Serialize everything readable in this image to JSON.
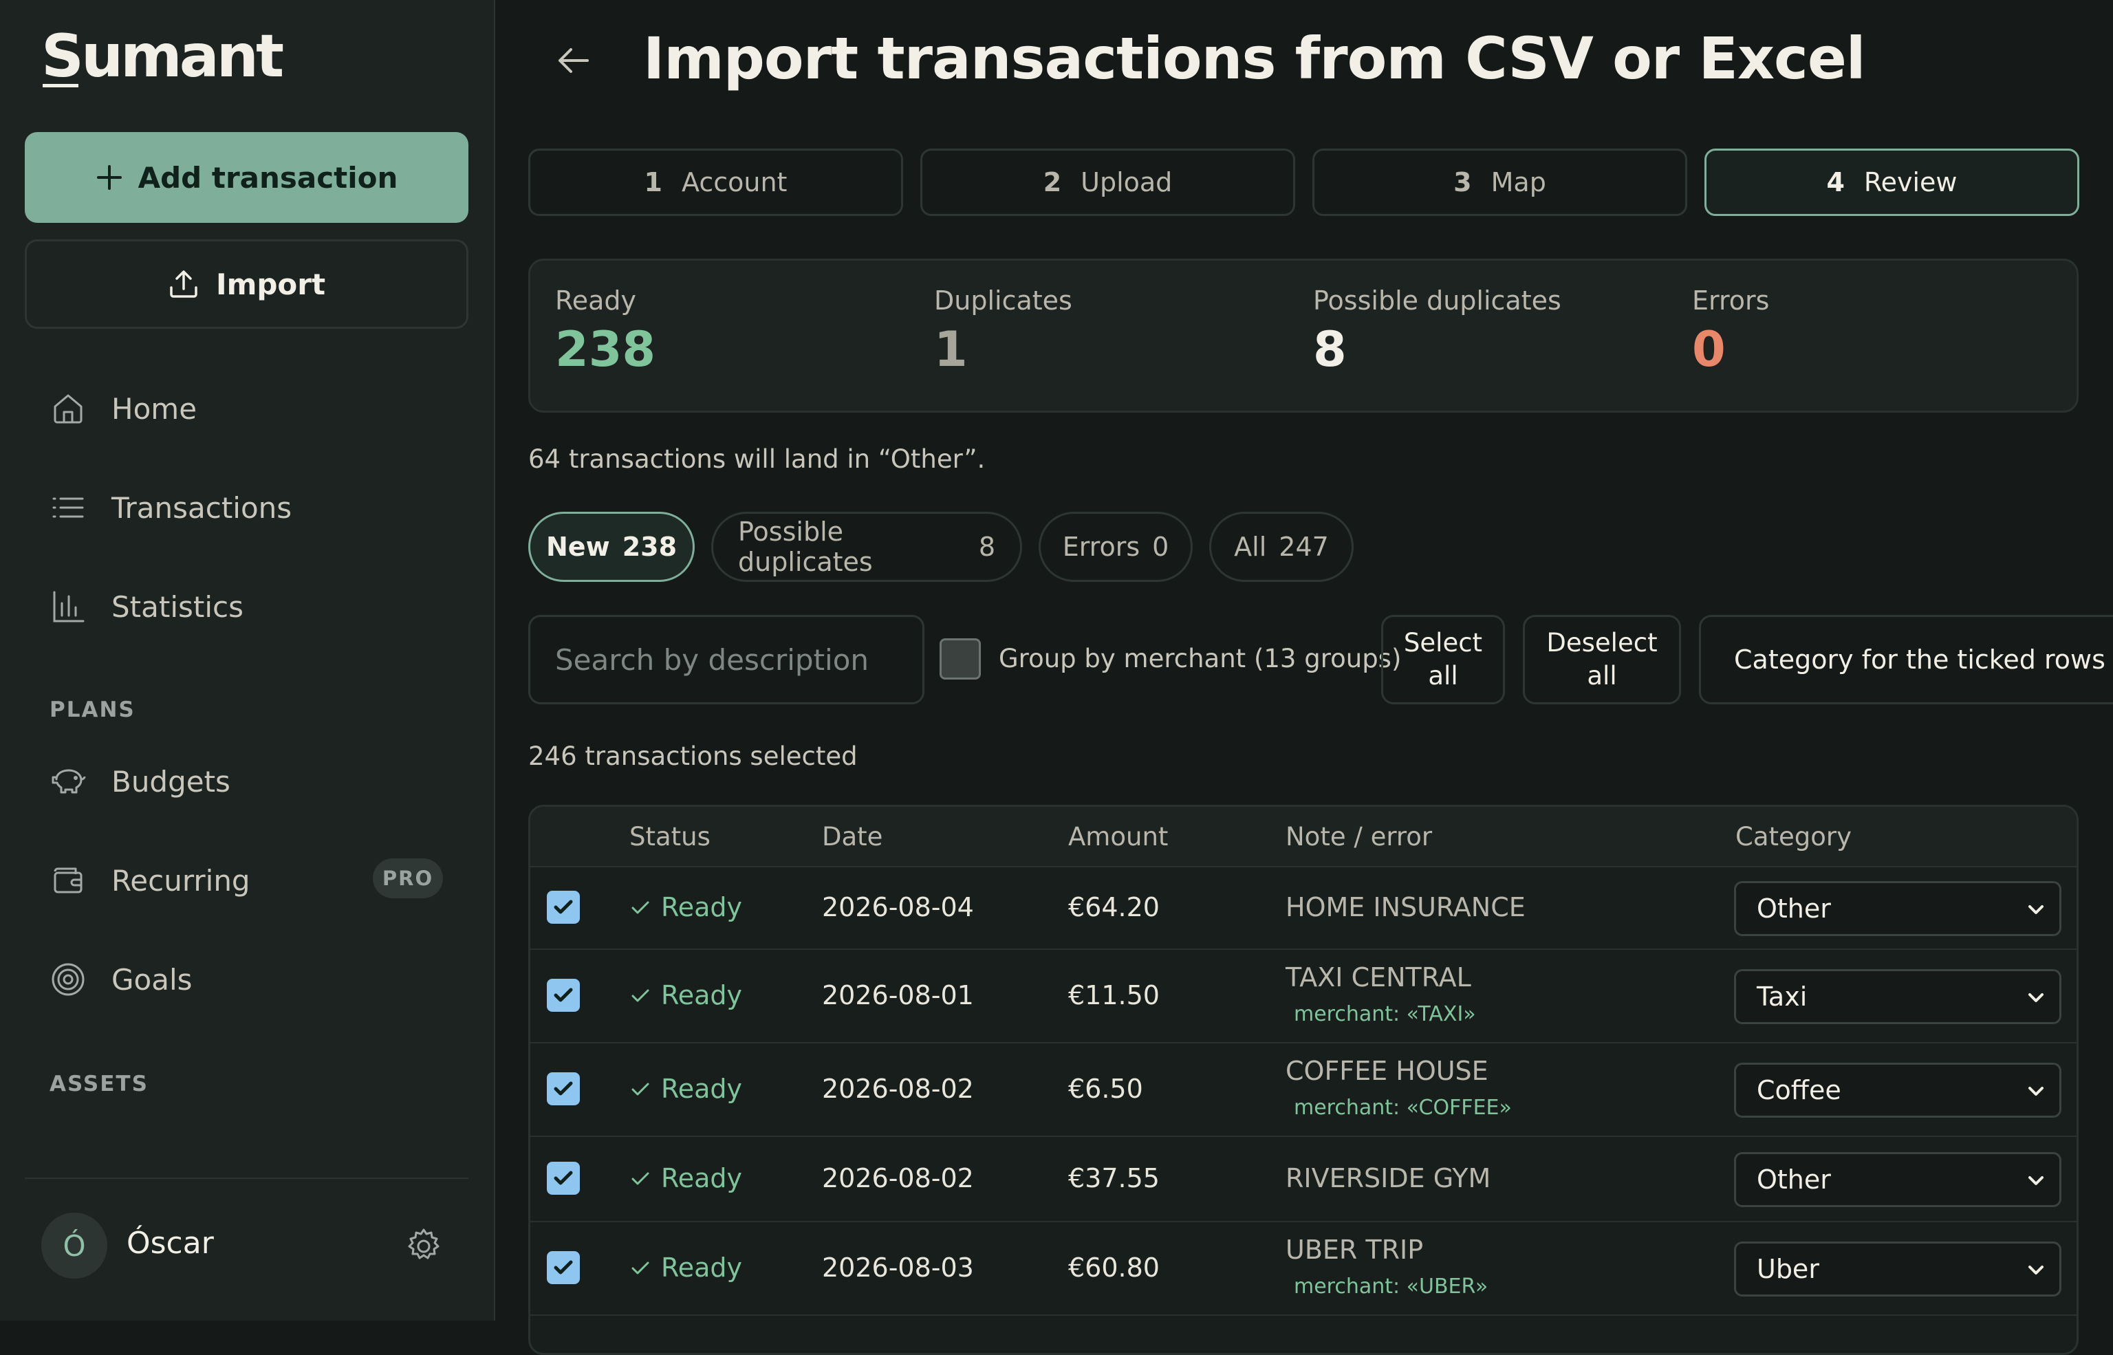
{
  "brand": {
    "name": "Sumant"
  },
  "sidebar": {
    "add_label": "Add transaction",
    "import_label": "Import",
    "nav": [
      {
        "label": "Home",
        "icon": "home-icon"
      },
      {
        "label": "Transactions",
        "icon": "list-icon"
      },
      {
        "label": "Statistics",
        "icon": "bar-chart-icon"
      }
    ],
    "plans_label": "PLANS",
    "plans": [
      {
        "label": "Budgets",
        "icon": "piggy-bank-icon"
      },
      {
        "label": "Recurring",
        "icon": "wallet-icon",
        "badge": "PRO"
      },
      {
        "label": "Goals",
        "icon": "target-icon"
      }
    ],
    "assets_label": "ASSETS",
    "user": {
      "initial": "Ó",
      "name": "Óscar"
    }
  },
  "page": {
    "title": "Import transactions from CSV or Excel"
  },
  "steps": [
    {
      "num": "1",
      "label": "Account"
    },
    {
      "num": "2",
      "label": "Upload"
    },
    {
      "num": "3",
      "label": "Map"
    },
    {
      "num": "4",
      "label": "Review",
      "active": true
    }
  ],
  "stats": [
    {
      "label": "Ready",
      "value": "238",
      "color": "#7fc49a"
    },
    {
      "label": "Duplicates",
      "value": "1",
      "color": "#a7a49a"
    },
    {
      "label": "Possible duplicates",
      "value": "8",
      "color": "#f2efe6"
    },
    {
      "label": "Errors",
      "value": "0",
      "color": "#e8876a"
    }
  ],
  "notice": "64 transactions will land in “Other”.",
  "filters": [
    {
      "label": "New",
      "count": "238",
      "active": true
    },
    {
      "label": "Possible duplicates",
      "count": "8"
    },
    {
      "label": "Errors",
      "count": "0"
    },
    {
      "label": "All",
      "count": "247"
    }
  ],
  "toolbar": {
    "search_placeholder": "Search by description",
    "group_label": "Group by merchant (13 groups)",
    "select_all": "Select all",
    "deselect_all": "Deselect all",
    "category_dropdown": "Category for the ticked rows"
  },
  "selected_count": "246 transactions selected",
  "table": {
    "headers": {
      "status": "Status",
      "date": "Date",
      "amount": "Amount",
      "note": "Note / error",
      "category": "Category"
    },
    "rows": [
      {
        "status": "Ready",
        "date": "2026-08-04",
        "amount": "€64.20",
        "note": "HOME INSURANCE",
        "merchant": "",
        "category": "Other"
      },
      {
        "status": "Ready",
        "date": "2026-08-01",
        "amount": "€11.50",
        "note": "TAXI CENTRAL",
        "merchant": "merchant: «TAXI»",
        "category": "Taxi"
      },
      {
        "status": "Ready",
        "date": "2026-08-02",
        "amount": "€6.50",
        "note": "COFFEE HOUSE",
        "merchant": "merchant: «COFFEE»",
        "category": "Coffee"
      },
      {
        "status": "Ready",
        "date": "2026-08-02",
        "amount": "€37.55",
        "note": "RIVERSIDE GYM",
        "merchant": "",
        "category": "Other"
      },
      {
        "status": "Ready",
        "date": "2026-08-03",
        "amount": "€60.80",
        "note": "UBER TRIP",
        "merchant": "merchant: «UBER»",
        "category": "Uber"
      }
    ]
  }
}
